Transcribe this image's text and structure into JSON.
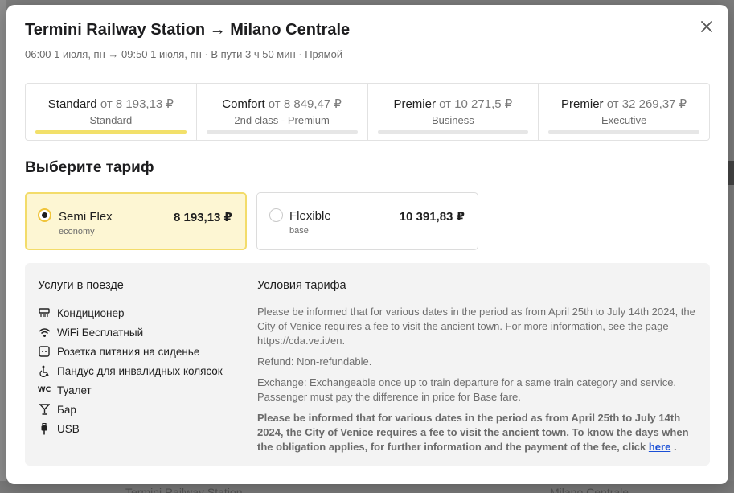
{
  "backdrop": {
    "bottom_left_text": "Termini Railway Station",
    "bottom_right_text": "Milano Centrale"
  },
  "modal": {
    "title": "Termini Railway Station → Milano Centrale",
    "subtitle": "06:00 1 июля, пн → 09:50 1 июля, пн · В пути 3 ч 50 мин · Прямой",
    "close_icon": "close-icon"
  },
  "classes": [
    {
      "name": "Standard",
      "price": "от 8 193,13 ₽",
      "sub": "Standard",
      "active": true
    },
    {
      "name": "Comfort",
      "price": "от 8 849,47 ₽",
      "sub": "2nd class - Premium",
      "active": false
    },
    {
      "name": "Premier",
      "price": "от 10 271,5 ₽",
      "sub": "Business",
      "active": false
    },
    {
      "name": "Premier",
      "price": "от 32 269,37 ₽",
      "sub": "Executive",
      "active": false
    }
  ],
  "tariff_section_title": "Выберите тариф",
  "tariffs": [
    {
      "name": "Semi Flex",
      "sub": "economy",
      "price": "8 193,13 ₽",
      "selected": true
    },
    {
      "name": "Flexible",
      "sub": "base",
      "price": "10 391,83 ₽",
      "selected": false
    }
  ],
  "services": {
    "title": "Услуги в поезде",
    "items": [
      {
        "label": "Кондиционер",
        "icon": "air-conditioner-icon"
      },
      {
        "label": "WiFi Бесплатный",
        "icon": "wifi-icon"
      },
      {
        "label": "Розетка питания на сиденье",
        "icon": "power-outlet-icon"
      },
      {
        "label": "Пандус для инвалидных колясок",
        "icon": "wheelchair-icon"
      },
      {
        "label": "Туалет",
        "icon": "wc-icon"
      },
      {
        "label": "Бар",
        "icon": "bar-icon"
      },
      {
        "label": "USB",
        "icon": "usb-icon"
      }
    ]
  },
  "conditions": {
    "title": "Условия тарифа",
    "p1": "Please be informed that for various dates in the period as from April 25th to July 14th 2024, the City of Venice requires a fee to visit the ancient town. For more information, see the page https://cda.ve.it/en.",
    "p2": "Refund: Non-refundable.",
    "p3": "Exchange: Exchangeable once up to train departure for a same train category and service. Passenger must pay the difference in price for Base fare.",
    "p4": "Please be informed that for various dates in the period as from April 25th to July 14th 2024, the City of Venice requires a fee to visit the ancient town. To know the days when the obligation applies, for further information and the payment of the fee, click",
    "p4_link": "here",
    "p4_end": "."
  },
  "colors": {
    "accent_yellow": "#f2e06a",
    "selected_bg": "#fdf6d3",
    "link": "#1a4fd6"
  }
}
